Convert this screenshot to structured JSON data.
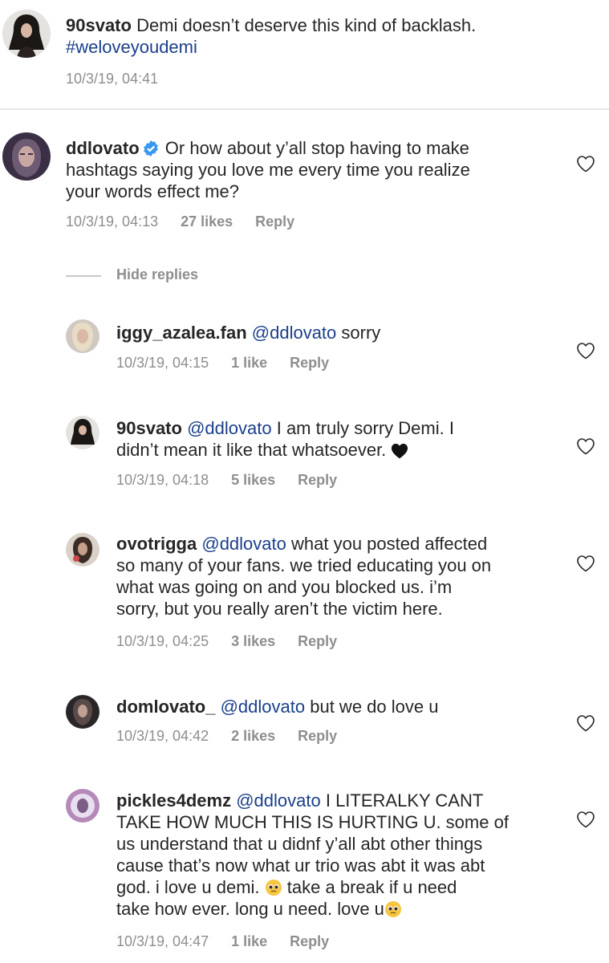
{
  "top_comment": {
    "username": "90svato",
    "text": "Demi doesn’t deserve this kind of backlash.",
    "hashtag": "#weloveyoudemi",
    "timestamp": "10/3/19, 04:41"
  },
  "main_comment": {
    "username": "ddlovato",
    "verified": true,
    "text_line1": "Or how about y’all stop having to make",
    "text_line2": "hashtags saying you love me every time you realize",
    "text_line3": "your words effect me?",
    "timestamp": "10/3/19, 04:13",
    "likes": "27 likes",
    "reply_label": "Reply"
  },
  "hide_replies_label": "Hide replies",
  "replies": [
    {
      "username": "iggy_azalea.fan",
      "mention": "@ddlovato",
      "text_line1": "sorry",
      "timestamp": "10/3/19, 04:15",
      "likes": "1 like",
      "reply_label": "Reply"
    },
    {
      "username": "90svato",
      "mention": "@ddlovato",
      "text_line1": "I am truly sorry Demi. I",
      "text_line2": "didn’t mean it like that whatsoever.",
      "emoji": "black-heart",
      "timestamp": "10/3/19, 04:18",
      "likes": "5 likes",
      "reply_label": "Reply"
    },
    {
      "username": "ovotrigga",
      "mention": "@ddlovato",
      "text_line1": "what you posted affected",
      "text_line2": "so many of your fans. we tried educating you on",
      "text_line3": "what was going on and you blocked us. i’m",
      "text_line4": "sorry, but you really aren’t the victim here.",
      "timestamp": "10/3/19, 04:25",
      "likes": "3 likes",
      "reply_label": "Reply"
    },
    {
      "username": "domlovato_",
      "mention": "@ddlovato",
      "text_line1": "but we do love u",
      "timestamp": "10/3/19, 04:42",
      "likes": "2 likes",
      "reply_label": "Reply"
    },
    {
      "username": "pickles4demz",
      "mention": "@ddlovato",
      "text_line1": "I LITERALKY CANT",
      "text_line2": "TAKE HOW MUCH THIS IS HURTING U. some of",
      "text_line3": "us understand that u didnf y’all abt other things",
      "text_line4": "cause that’s now what ur trio was abt it was abt",
      "text_line5a": "god. i love u demi.",
      "text_line5b": "take a break if u need",
      "text_line6": "take how ever. long u need. love u",
      "emoji": "pleading-face",
      "timestamp": "10/3/19, 04:47",
      "likes": "1 like",
      "reply_label": "Reply"
    }
  ],
  "icons": {
    "like": "heart-outline-icon",
    "verified": "verified-badge-icon"
  },
  "colors": {
    "text": "#262626",
    "meta": "#8e8e8e",
    "link": "#1b3f8b",
    "verified": "#3897f0"
  }
}
